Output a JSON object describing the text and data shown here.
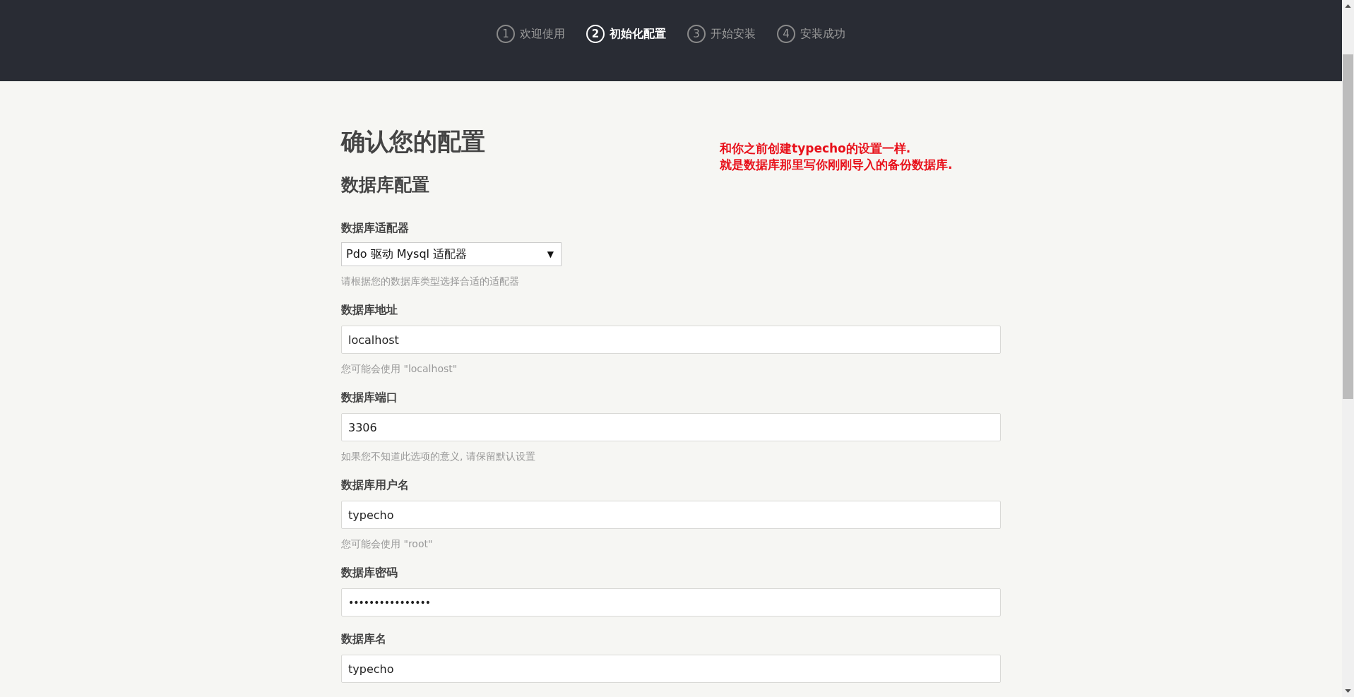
{
  "steps": [
    {
      "number": "1",
      "label": "欢迎使用",
      "selected": false
    },
    {
      "number": "2",
      "label": "初始化配置",
      "selected": true
    },
    {
      "number": "3",
      "label": "开始安装",
      "selected": false
    },
    {
      "number": "4",
      "label": "安装成功",
      "selected": false
    }
  ],
  "title": "确认您的配置",
  "annotation": [
    "和你之前创建typecho的设置一样.",
    "就是数据库那里写你刚刚导入的备份数据库."
  ],
  "section_title": "数据库配置",
  "fields": [
    {
      "kind": "select",
      "label": "数据库适配器",
      "value": "Pdo 驱动 Mysql 适配器",
      "caret": "▼",
      "hint": "请根据您的数据库类型选择合适的适配器"
    },
    {
      "kind": "text",
      "label": "数据库地址",
      "value": "localhost",
      "hint": "您可能会使用 \"localhost\""
    },
    {
      "kind": "text",
      "label": "数据库端口",
      "value": "3306",
      "hint": "如果您不知道此选项的意义, 请保留默认设置"
    },
    {
      "kind": "text",
      "label": "数据库用户名",
      "value": "typecho",
      "hint": "您可能会使用 \"root\""
    },
    {
      "kind": "password",
      "label": "数据库密码",
      "value": "••••••••••••••••"
    },
    {
      "kind": "text",
      "label": "数据库名",
      "value": "typecho"
    }
  ]
}
